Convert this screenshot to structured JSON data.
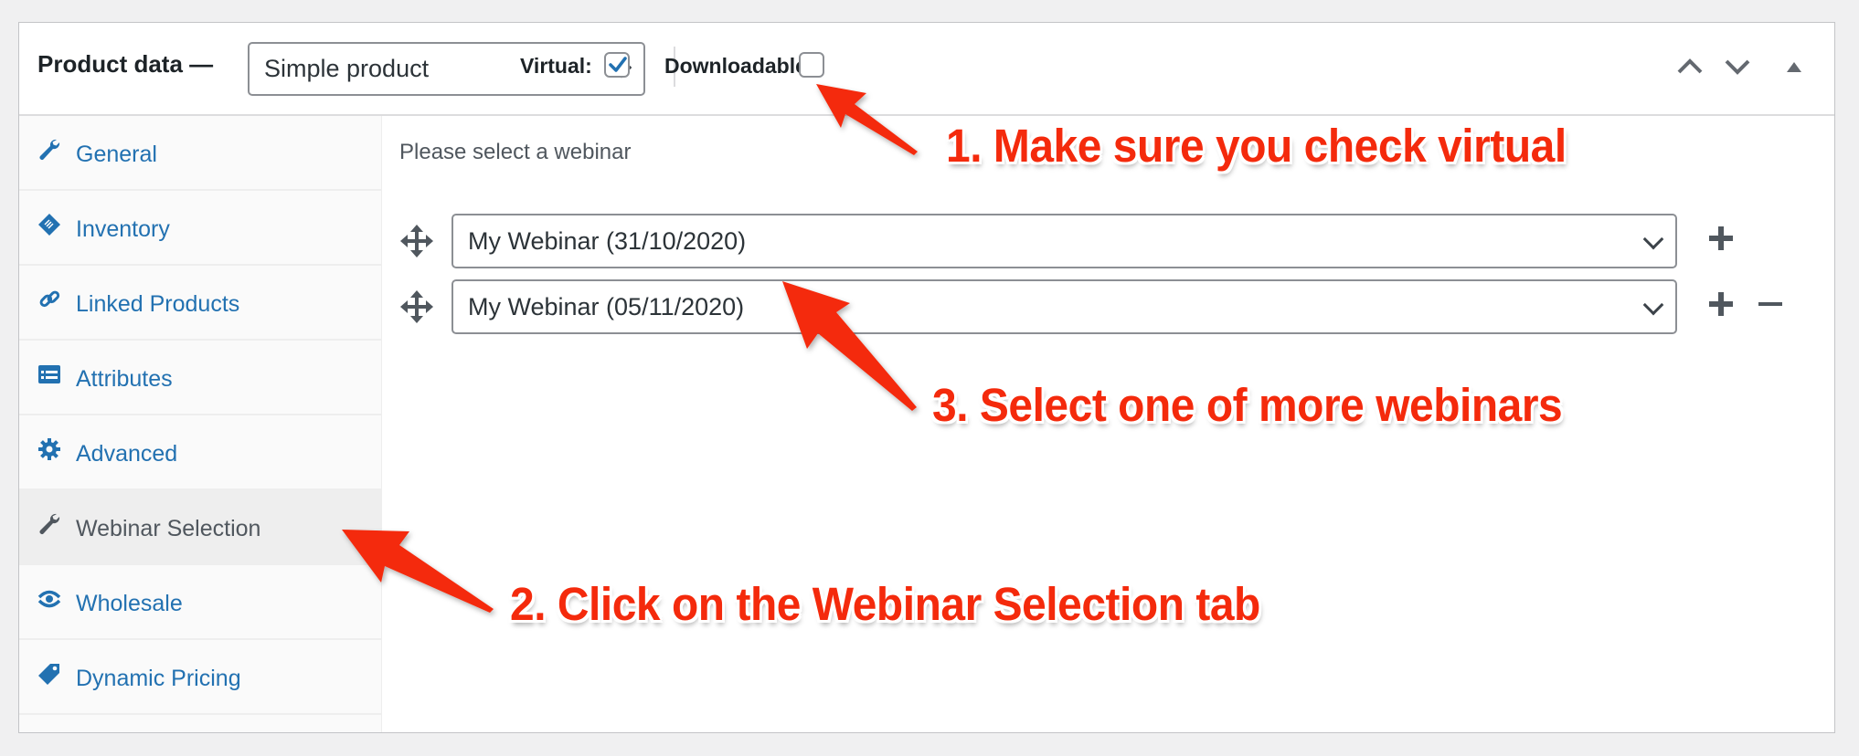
{
  "header": {
    "title": "Product data —",
    "product_type": {
      "selected": "Simple product"
    },
    "virtual": {
      "label": "Virtual:",
      "checked": true
    },
    "downloadable": {
      "label": "Downloadable:",
      "checked": false
    },
    "controls": [
      "move-up-icon",
      "move-down-icon",
      "collapse-toggle-icon"
    ]
  },
  "sidebar": {
    "items": [
      {
        "label": "General",
        "icon": "wrench-icon",
        "active": false
      },
      {
        "label": "Inventory",
        "icon": "clipboard-icon",
        "active": false
      },
      {
        "label": "Linked Products",
        "icon": "link-icon",
        "active": false
      },
      {
        "label": "Attributes",
        "icon": "list-table-icon",
        "active": false
      },
      {
        "label": "Advanced",
        "icon": "gear-icon",
        "active": false
      },
      {
        "label": "Webinar Selection",
        "icon": "wrench-icon",
        "active": true
      },
      {
        "label": "Wholesale",
        "icon": "eye-icon",
        "active": false
      },
      {
        "label": "Dynamic Pricing",
        "icon": "tag-icon",
        "active": false
      }
    ]
  },
  "main": {
    "hint": "Please select a webinar",
    "webinars": [
      {
        "selected": "My Webinar (31/10/2020)",
        "can_remove": false
      },
      {
        "selected": "My Webinar (05/11/2020)",
        "can_remove": true
      }
    ]
  },
  "annotations": {
    "step1": "1. Make sure you check virtual",
    "step2": "2. Click on the Webinar Selection tab",
    "step3": "3. Select one of more webinars",
    "color": "#f42a0c"
  },
  "colors": {
    "link": "#2271b1",
    "active_tab_text": "#50575e",
    "checkbox_check": "#2271b1"
  }
}
